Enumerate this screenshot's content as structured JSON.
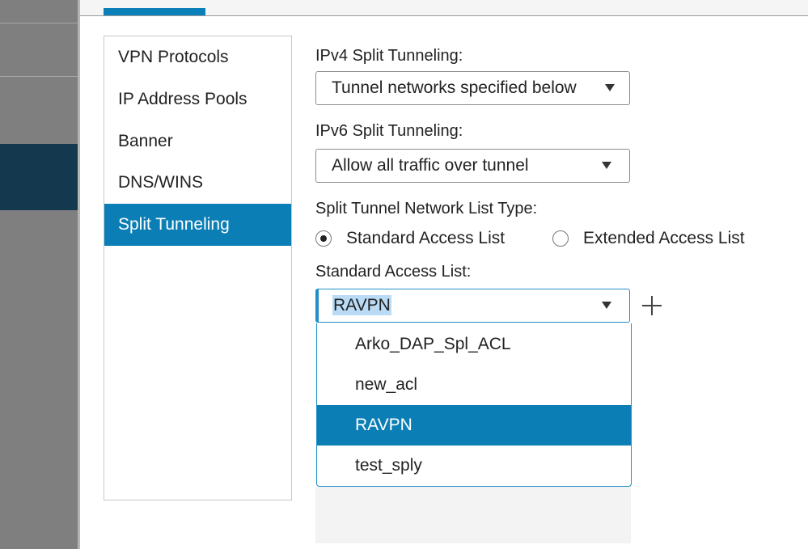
{
  "nav": {
    "items": [
      {
        "label": "VPN Protocols",
        "selected": false
      },
      {
        "label": "IP Address Pools",
        "selected": false
      },
      {
        "label": "Banner",
        "selected": false
      },
      {
        "label": "DNS/WINS",
        "selected": false
      },
      {
        "label": "Split Tunneling",
        "selected": true
      }
    ]
  },
  "form": {
    "ipv4": {
      "label": "IPv4 Split Tunneling:",
      "value": "Tunnel networks specified below"
    },
    "ipv6": {
      "label": "IPv6 Split Tunneling:",
      "value": "Allow all traffic over tunnel"
    },
    "list_type": {
      "label": "Split Tunnel Network List Type:",
      "options": [
        {
          "label": "Standard Access List",
          "checked": true
        },
        {
          "label": "Extended Access List",
          "checked": false
        }
      ]
    },
    "standard_acl": {
      "label": "Standard Access List:",
      "value": "RAVPN",
      "options": [
        "Arko_DAP_Spl_ACL",
        "new_acl",
        "RAVPN",
        "test_sply"
      ],
      "selected_option": "RAVPN"
    }
  },
  "icons": {
    "add": "plus-icon",
    "dropdown": "chevron-down-icon",
    "radio": "radio-icon"
  },
  "colors": {
    "accent": "#0b7fb5",
    "focus": "#1f8fc6",
    "highlight": "#b9dbf6",
    "sidebar_active": "#14384e"
  }
}
